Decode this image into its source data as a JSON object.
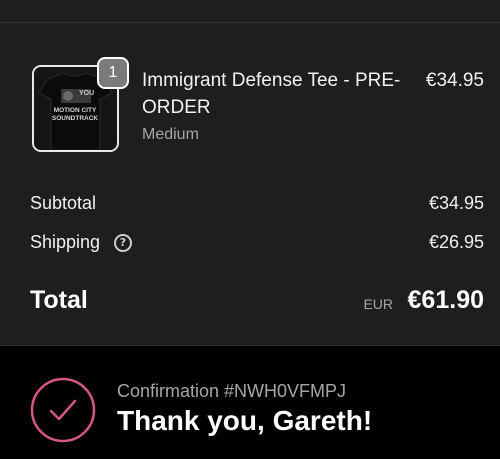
{
  "order": {
    "item": {
      "title": "Immigrant Defense Tee - PRE-ORDER",
      "variant": "Medium",
      "price": "€34.95",
      "quantity": "1",
      "image_text": "YOU MOTION CITY SOUNDTRACK"
    },
    "subtotal": {
      "label": "Subtotal",
      "value": "€34.95"
    },
    "shipping": {
      "label": "Shipping",
      "value": "€26.95",
      "help_glyph": "?"
    },
    "total": {
      "label": "Total",
      "currency": "EUR",
      "value": "€61.90"
    }
  },
  "confirmation": {
    "label": "Confirmation #NWH0VFMPJ",
    "thanks": "Thank you, Gareth!"
  },
  "colors": {
    "summary_bg": "#1e1e1e",
    "page_bg": "#000000",
    "accent": "#d6577f",
    "muted_text": "#a6a6a6"
  }
}
